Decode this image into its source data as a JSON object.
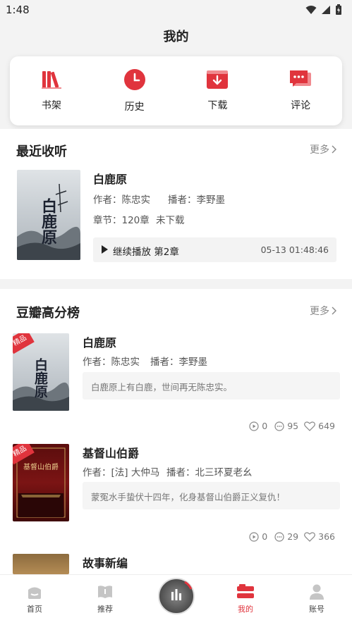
{
  "status": {
    "time": "1:48"
  },
  "page": {
    "title": "我的"
  },
  "quick": [
    {
      "label": "书架",
      "icon": "bookshelf-icon"
    },
    {
      "label": "历史",
      "icon": "clock-icon"
    },
    {
      "label": "下载",
      "icon": "download-icon"
    },
    {
      "label": "评论",
      "icon": "comment-icon"
    }
  ],
  "recent": {
    "title": "最近收听",
    "more": "更多",
    "book": {
      "title": "白鹿原",
      "author": "作者：陈忠实",
      "narrator": "播者：李野墨",
      "chapters": "章节：120章",
      "download": "未下载",
      "continue": "继续播放 第2章",
      "time": "05-13 01:48:46",
      "cover_text": "白鹿原"
    }
  },
  "douban": {
    "title": "豆瓣高分榜",
    "more": "更多",
    "badge": "精品",
    "books": [
      {
        "title": "白鹿原",
        "author": "作者：陈忠实",
        "narrator": "播者：李野墨",
        "quote": "白鹿原上有白鹿，世间再无陈忠实。",
        "plays": "0",
        "comments": "95",
        "likes": "649",
        "cover_text": "白鹿原"
      },
      {
        "title": "基督山伯爵",
        "author": "作者：[法] 大仲马",
        "narrator": "播者：北三环夏老幺",
        "quote": "蒙冤水手蛰伏十四年，化身基督山伯爵正义复仇！",
        "plays": "0",
        "comments": "29",
        "likes": "366",
        "cover_text": "基督山伯爵"
      },
      {
        "title": "故事新编"
      }
    ]
  },
  "tabs": [
    {
      "label": "首页",
      "icon": "home-icon"
    },
    {
      "label": "推荐",
      "icon": "book-icon"
    },
    {
      "label": "我的",
      "icon": "mine-icon"
    },
    {
      "label": "账号",
      "icon": "account-icon"
    }
  ],
  "colors": {
    "accent": "#e0343d"
  }
}
